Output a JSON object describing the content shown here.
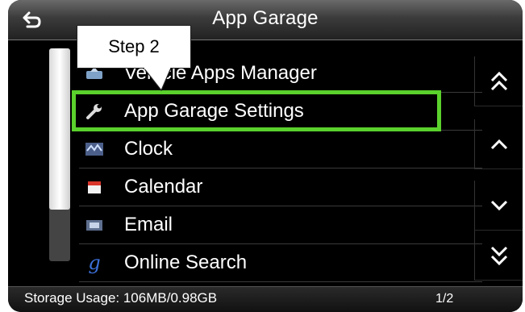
{
  "header": {
    "title": "App Garage",
    "back_icon": "back-arrow-icon"
  },
  "callout": {
    "text": "Step 2"
  },
  "list": {
    "items": [
      {
        "label": "Vehicle Apps Manager",
        "icon": "vehicle-apps-icon",
        "selected": false
      },
      {
        "label": "App Garage Settings",
        "icon": "wrench-icon",
        "selected": true
      },
      {
        "label": "Clock",
        "icon": "clock-icon",
        "selected": false
      },
      {
        "label": "Calendar",
        "icon": "calendar-icon",
        "selected": false
      },
      {
        "label": "Email",
        "icon": "email-icon",
        "selected": false
      },
      {
        "label": "Online Search",
        "icon": "google-g-icon",
        "selected": false
      }
    ]
  },
  "scrollbar": {
    "position_fraction": 0.0,
    "visible_fraction": 0.75
  },
  "side_buttons": {
    "page_up": "double-chevron-up-icon",
    "line_up": "chevron-up-icon",
    "line_down": "chevron-down-icon",
    "page_down": "double-chevron-down-icon"
  },
  "footer": {
    "storage": "Storage Usage: 106MB/0.98GB",
    "page": "1/2"
  },
  "colors": {
    "highlight": "#5ad12c",
    "background": "#000000",
    "text": "#ffffff"
  }
}
